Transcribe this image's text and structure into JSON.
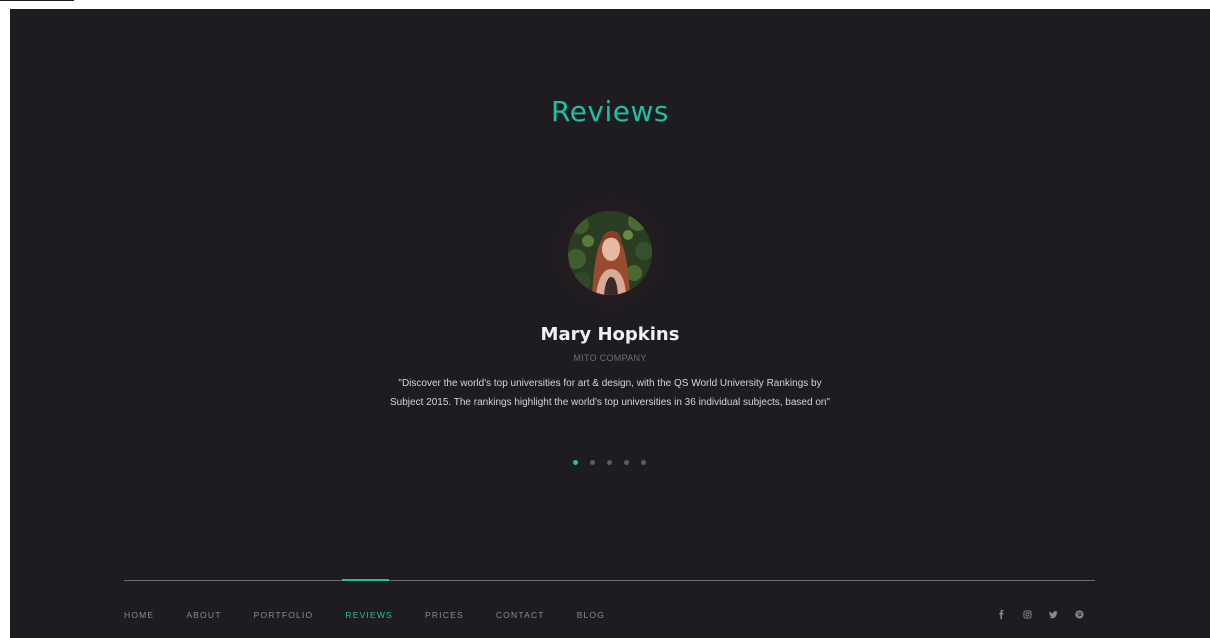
{
  "section": {
    "title": "Reviews"
  },
  "review": {
    "name": "Mary Hopkins",
    "company": "MITO COMPANY",
    "text": "\"Discover the world's top universities for art & design, with the QS World University Rankings by Subject 2015. The rankings highlight the world's top universities in 36 individual subjects, based on\"",
    "avatar_icon": "reviewer-avatar-photo",
    "slider": {
      "total": 5,
      "active_index": 0
    }
  },
  "footer": {
    "nav": [
      {
        "label": "HOME",
        "active": false
      },
      {
        "label": "ABOUT",
        "active": false
      },
      {
        "label": "PORTFOLIO",
        "active": false
      },
      {
        "label": "REVIEWS",
        "active": true
      },
      {
        "label": "PRICES",
        "active": false
      },
      {
        "label": "CONTACT",
        "active": false
      },
      {
        "label": "BLOG",
        "active": false
      }
    ],
    "social_icons": [
      "facebook-icon",
      "instagram-icon",
      "twitter-icon",
      "pinterest-icon"
    ]
  },
  "colors": {
    "background": "#1e1c21",
    "accent": "#1fbf9f",
    "text_primary": "#f2f2f2",
    "text_muted": "#8d8a91"
  }
}
